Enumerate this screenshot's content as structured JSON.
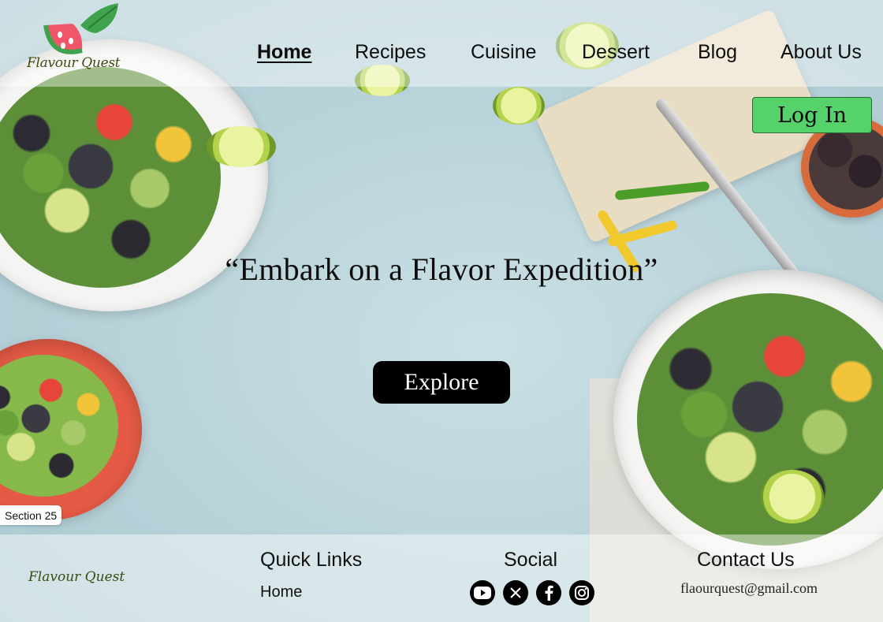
{
  "brand": {
    "name": "Flavour Quest"
  },
  "nav": {
    "items": [
      {
        "label": "Home",
        "active": true
      },
      {
        "label": "Recipes",
        "active": false
      },
      {
        "label": "Cuisine",
        "active": false
      },
      {
        "label": "Dessert",
        "active": false
      },
      {
        "label": "Blog",
        "active": false
      },
      {
        "label": "About Us",
        "active": false
      }
    ],
    "login_label": "Log In"
  },
  "hero": {
    "title": "“Embark on a Flavor Expedition”",
    "cta_label": "Explore"
  },
  "section_tag": "Section 25",
  "footer": {
    "brand": "Flavour Quest",
    "quick_links": {
      "heading": "Quick Links",
      "items": [
        "Home"
      ]
    },
    "social": {
      "heading": "Social",
      "icons": [
        "youtube-icon",
        "x-icon",
        "facebook-icon",
        "instagram-icon"
      ]
    },
    "contact": {
      "heading": "Contact Us",
      "email": "flaourquest@gmail.com"
    }
  },
  "colors": {
    "login_button": "#55d36a",
    "explore_button": "#000000",
    "logo_watermelon": "#f0566a",
    "logo_leaf": "#3fa34d"
  }
}
